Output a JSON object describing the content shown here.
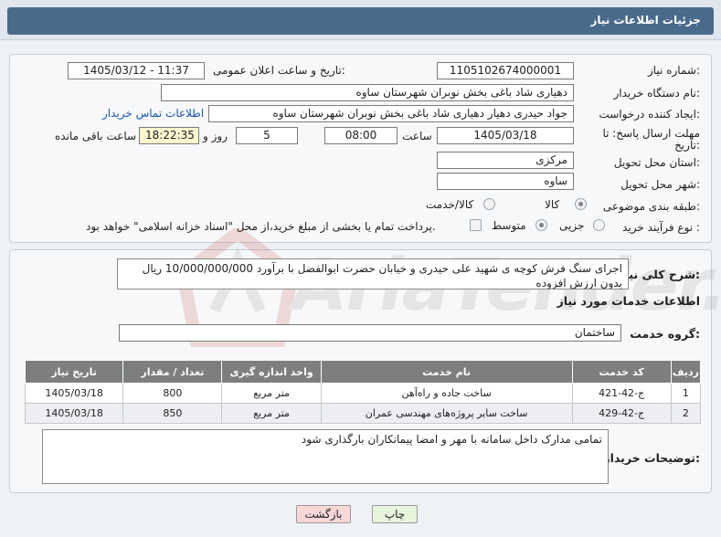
{
  "header": {
    "title": "جزئیات اطلاعات نیاز"
  },
  "form": {
    "need_number_label": "شماره نیاز:",
    "need_number": "1105102674000001",
    "announce_label": "تاریخ و ساعت اعلان عمومی:",
    "announce_value": "1405/03/12 - 11:37",
    "buyer_org_label": "نام دستگاه خریدار:",
    "buyer_org": "دهیاری شاد باغی بخش نوبران شهرستان ساوه",
    "creator_label": "ایجاد کننده درخواست:",
    "creator": "جواد حیدری دهیار دهیاری شاد باغی بخش نوبران شهرستان ساوه",
    "contact_link": "اطلاعات تماس خریدار",
    "deadline_label_1": "مهلت ارسال پاسخ: تا",
    "deadline_label_2": "تاریخ:",
    "deadline_date": "1405/03/18",
    "time_label": "ساعت",
    "deadline_time": "08:00",
    "days_value": "5",
    "days_label": "روز و",
    "remaining_time": "18:22:35",
    "remaining_label": "ساعت باقی مانده",
    "province_label": "استان محل تحویل:",
    "province": "مرکزی",
    "city_label": "شهر محل تحویل:",
    "city": "ساوه",
    "category_label": "طبقه بندی موضوعی:",
    "category_options": [
      "کالا",
      "کالا/خدمت"
    ],
    "process_label": "نوع فرآیند خرید :",
    "process_options": [
      "جزیی",
      "متوسط"
    ],
    "payment_note": "پرداخت تمام یا بخشی از مبلغ خرید،از محل \"اسناد خزانه اسلامی\" خواهد بود."
  },
  "details": {
    "summary_label": "شرح کلی نیاز:",
    "summary": "اجرای سنگ فرش کوچه ی شهید علی حیدری و خیابان حضرت ابوالفضل با برآورد 10/000/000/000 ریال بدون ارزش افزوده",
    "services_title": "اطلاعات خدمات مورد نیاز",
    "service_group_label": "گروه خدمت:",
    "service_group": "ساختمان",
    "table": {
      "headers": [
        "ردیف",
        "کد خدمت",
        "نام خدمت",
        "واحد اندازه گیری",
        "تعداد / مقدار",
        "تاریخ نیاز"
      ],
      "rows": [
        [
          "1",
          "ج-42-421",
          "ساخت جاده و راه‌آهن",
          "متر مربع",
          "800",
          "1405/03/18"
        ],
        [
          "2",
          "ج-42-429",
          "ساخت سایر پروژه‌های مهندسی عمران",
          "متر مربع",
          "850",
          "1405/03/18"
        ]
      ]
    },
    "buyer_notes_label": "توضیحات خریدار:",
    "buyer_notes": "تمامی مدارک داخل سامانه با مهر و امضا پیمانکاران بارگذاری شود"
  },
  "buttons": {
    "print": "چاپ",
    "back": "بازگشت"
  },
  "watermark": {
    "text": "AriaTender.net"
  },
  "colors": {
    "header": "#4a6a8c",
    "table_header": "#7c7e80",
    "back_button": "#f8d7d7",
    "print_button": "#e6f5dc",
    "link": "#1a55b5"
  }
}
